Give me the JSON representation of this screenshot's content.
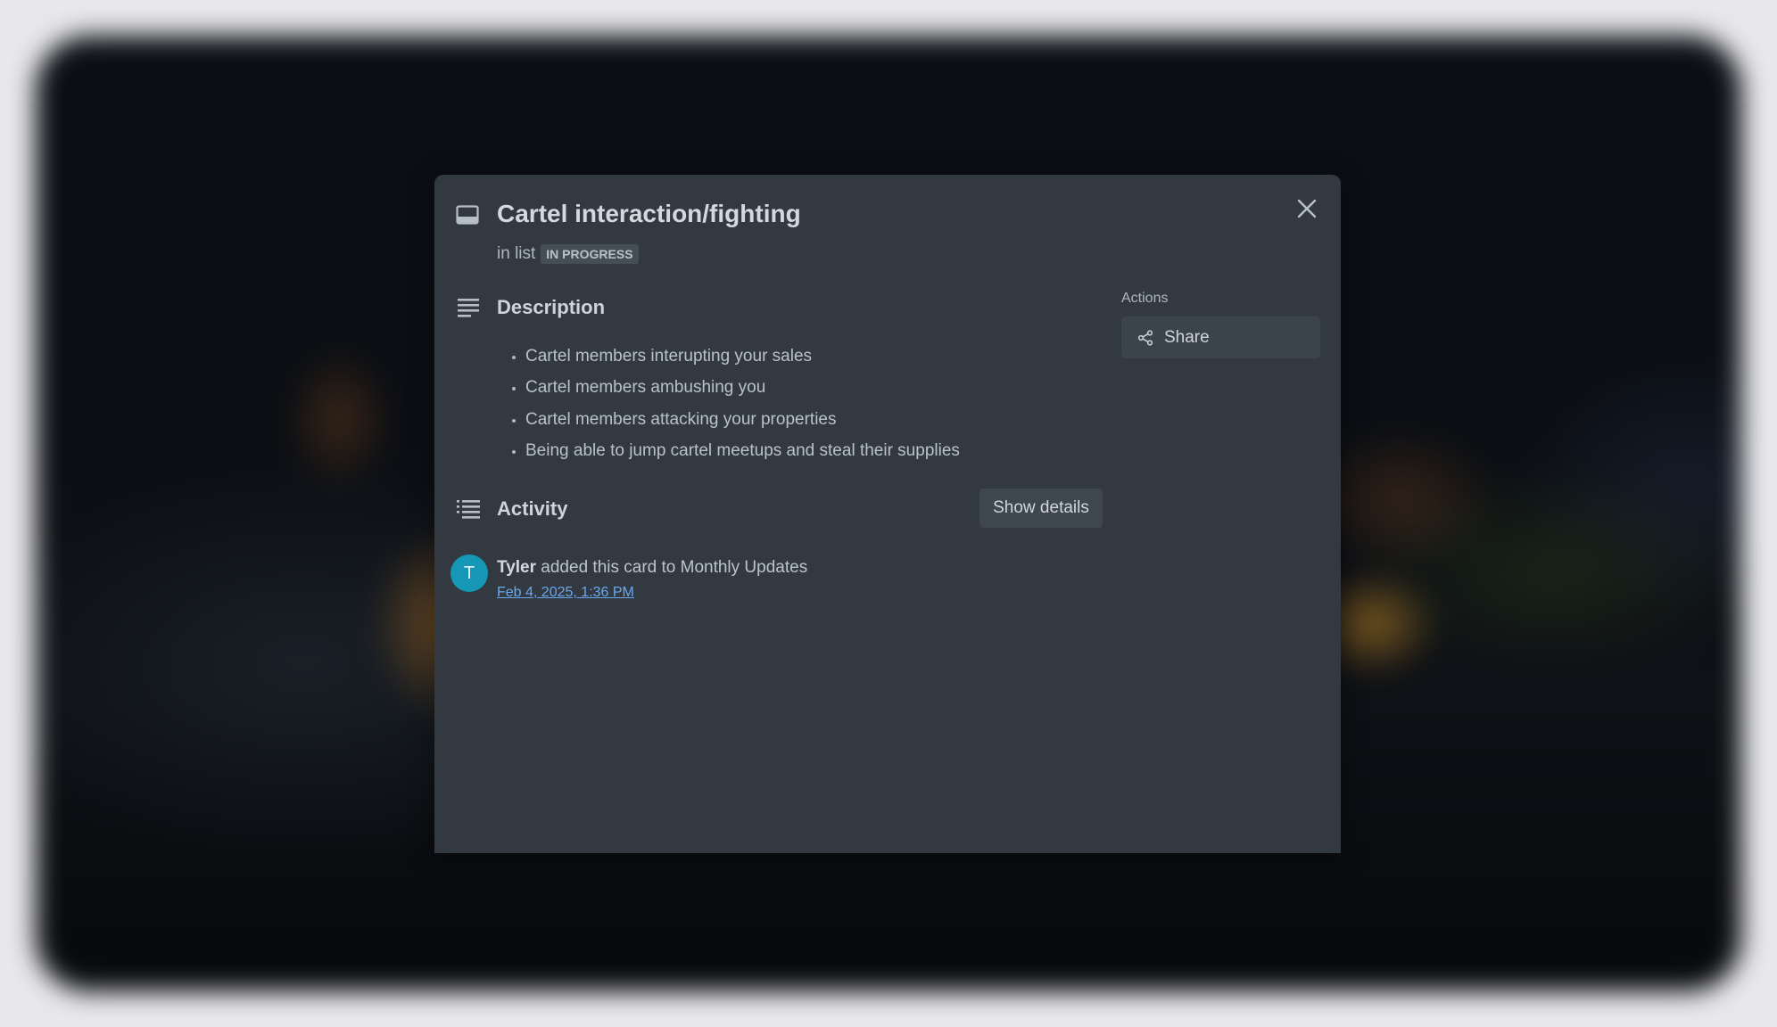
{
  "card": {
    "title": "Cartel interaction/fighting",
    "in_list_prefix": "in list",
    "list_name": "IN PROGRESS"
  },
  "description": {
    "heading": "Description",
    "items": [
      "Cartel members interupting your sales",
      "Cartel members ambushing you",
      "Cartel members attacking your properties",
      "Being able to jump cartel meetups and steal their supplies"
    ]
  },
  "activity": {
    "heading": "Activity",
    "show_details_label": "Show details",
    "entries": [
      {
        "avatar_initial": "T",
        "user": "Tyler",
        "text": "added this card to Monthly Updates",
        "timestamp": "Feb 4, 2025, 1:36 PM"
      }
    ]
  },
  "actions": {
    "label": "Actions",
    "share_label": "Share"
  },
  "icons": {
    "card": "card-icon",
    "close": "close-icon",
    "description": "description-lines-icon",
    "activity": "activity-list-icon",
    "share": "share-icon"
  },
  "colors": {
    "modal_bg": "#323940",
    "avatar_bg": "#1697b6",
    "link": "#6aa8f0",
    "badge_bg": "#454e57"
  }
}
